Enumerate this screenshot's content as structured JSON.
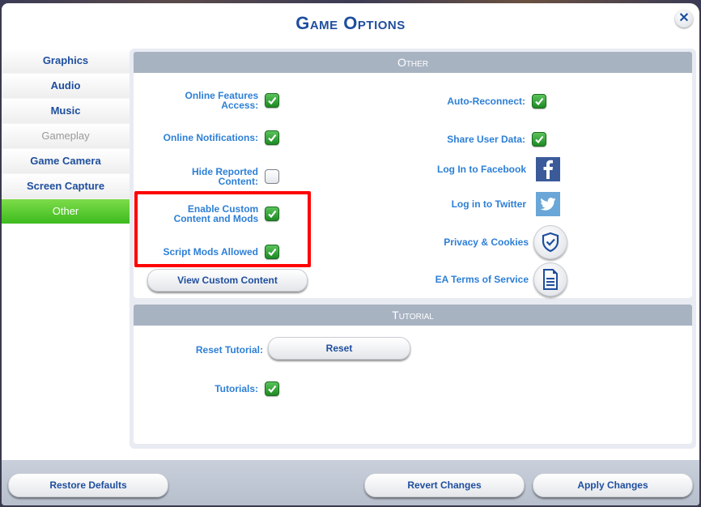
{
  "window": {
    "title": "Game Options",
    "close_icon": "close-icon"
  },
  "sidebar": {
    "items": [
      {
        "label": "Graphics",
        "state": "normal"
      },
      {
        "label": "Audio",
        "state": "normal"
      },
      {
        "label": "Music",
        "state": "normal"
      },
      {
        "label": "Gameplay",
        "state": "disabled"
      },
      {
        "label": "Game Camera",
        "state": "normal"
      },
      {
        "label": "Screen Capture",
        "state": "normal"
      },
      {
        "label": "Other",
        "state": "active"
      }
    ]
  },
  "other": {
    "header": "Other",
    "left": {
      "online_features": {
        "label": "Online Features Access:",
        "checked": true
      },
      "online_notifications": {
        "label": "Online Notifications:",
        "checked": true
      },
      "hide_reported": {
        "label": "Hide Reported Content:",
        "checked": false
      },
      "enable_custom_content": {
        "label": "Enable Custom Content and Mods",
        "checked": true
      },
      "script_mods": {
        "label": "Script Mods Allowed",
        "checked": true
      },
      "view_custom_content_button": "View Custom Content"
    },
    "right": {
      "auto_reconnect": {
        "label": "Auto-Reconnect:",
        "checked": true
      },
      "share_user_data": {
        "label": "Share User Data:",
        "checked": true
      },
      "facebook": {
        "label": "Log In to Facebook",
        "icon": "facebook-icon",
        "color": "#3b5a9a"
      },
      "twitter": {
        "label": "Log in to Twitter",
        "icon": "twitter-icon",
        "color": "#6aa6d8"
      },
      "privacy": {
        "label": "Privacy & Cookies",
        "icon": "shield-check-icon"
      },
      "terms": {
        "label": "EA Terms of Service",
        "icon": "document-icon"
      }
    }
  },
  "tutorial": {
    "header": "Tutorial",
    "reset_label": "Reset Tutorial:",
    "reset_button": "Reset",
    "tutorials": {
      "label": "Tutorials:",
      "checked": true
    }
  },
  "footer": {
    "restore_defaults": "Restore Defaults",
    "revert_changes": "Revert Changes",
    "apply_changes": "Apply Changes"
  },
  "colors": {
    "accent_blue": "#1e4e9e",
    "label_blue": "#2d7fd6",
    "active_green": "#3dbb1e",
    "highlight_red": "#ff0000",
    "header_gray": "#a8b3c2"
  }
}
